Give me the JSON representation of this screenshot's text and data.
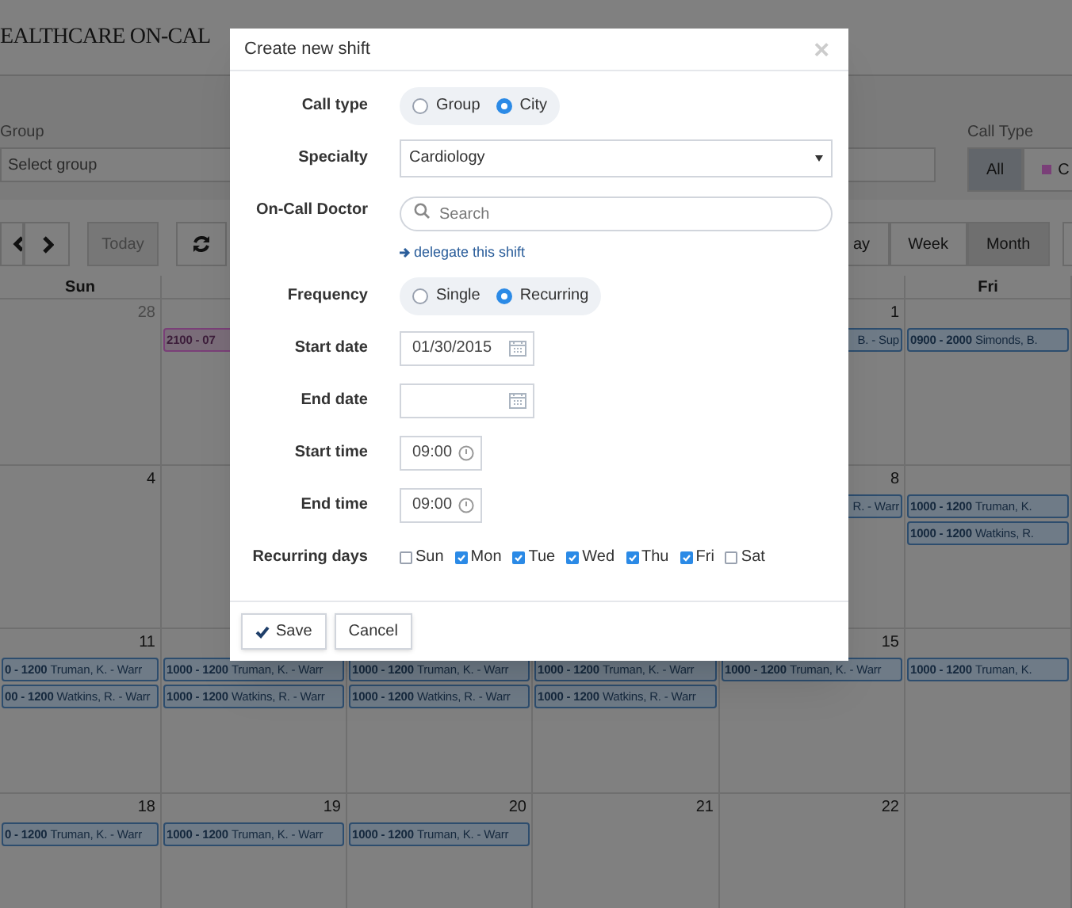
{
  "app_title": "EALTHCARE ON-CAL",
  "filters": {
    "group": {
      "label": "Group",
      "placeholder": "Select group"
    },
    "call_type": {
      "label": "Call Type",
      "options": [
        {
          "label": "All",
          "selected": true
        },
        {
          "label": "C",
          "selected": false,
          "color": "#7a3f78"
        }
      ]
    }
  },
  "toolbar": {
    "today": "Today",
    "views": [
      {
        "label": "ay",
        "selected": false
      },
      {
        "label": "Week",
        "selected": false
      },
      {
        "label": "Month",
        "selected": true
      }
    ]
  },
  "calendar": {
    "headers": {
      "column_1": "Sun",
      "column_6": "Fri"
    },
    "weeks": [
      {
        "days": {
          "column_1": {
            "number": "28"
          },
          "column_2": {
            "events": [
              {
                "time": "2100 - 07",
                "color": "#7a3f78"
              }
            ]
          },
          "column_5": {
            "number": "1",
            "events": [
              {
                "text": "B. - Sup",
                "clipped_left": true,
                "color": "#2d4d6e"
              }
            ]
          },
          "column_6": {
            "events": [
              {
                "time": "0900 - 2000",
                "text": "Simonds, B.",
                "color": "#2d4d6e"
              }
            ]
          }
        }
      },
      {
        "days": {
          "column_1": {
            "number": "4"
          },
          "column_5": {
            "number": "8",
            "events": [
              {
                "text": "R. - Warr",
                "clipped_left": true,
                "color": "#2d4d6e"
              }
            ]
          },
          "column_6": {
            "events": [
              {
                "time": "1000 - 1200",
                "text": "Truman, K.",
                "color": "#2d4d6e"
              },
              {
                "time": "1000 - 1200",
                "text": "Watkins, R.",
                "color": "#2d4d6e"
              }
            ]
          }
        }
      },
      {
        "days": {
          "column_1": {
            "number": "11",
            "events": [
              {
                "time": "0 - 1200",
                "text": "Truman, K. - Warr",
                "color": "#2d4d6e"
              },
              {
                "time": "00 - 1200",
                "text": "Watkins, R. - Warr",
                "color": "#2d4d6e"
              }
            ]
          },
          "column_2": {
            "events": [
              {
                "time": "1000 - 1200",
                "text": "Truman, K. - Warr",
                "color": "#2d4d6e"
              },
              {
                "time": "1000 - 1200",
                "text": "Watkins, R. - Warr",
                "color": "#2d4d6e"
              }
            ]
          },
          "column_3": {
            "events": [
              {
                "time": "1000 - 1200",
                "text": "Truman, K. - Warr",
                "color": "#2d4d6e"
              },
              {
                "time": "1000 - 1200",
                "text": "Watkins, R. - Warr",
                "color": "#2d4d6e"
              }
            ]
          },
          "column_4": {
            "events": [
              {
                "time": "1000 - 1200",
                "text": "Truman, K. - Warr",
                "color": "#2d4d6e"
              },
              {
                "time": "1000 - 1200",
                "text": "Watkins, R. - Warr",
                "color": "#2d4d6e"
              }
            ]
          },
          "column_5": {
            "number": "15",
            "events": [
              {
                "time": "1000 - 1200",
                "text": "Truman, K. - Warr",
                "color": "#2d4d6e"
              }
            ]
          },
          "column_6": {
            "events": [
              {
                "time": "1000 - 1200",
                "text": "Truman, K.",
                "color": "#2d4d6e"
              }
            ]
          }
        }
      },
      {
        "days": {
          "column_1": {
            "number": "18",
            "events": [
              {
                "time": "0 - 1200",
                "text": "Truman, K. - Warr",
                "color": "#2d4d6e"
              }
            ]
          },
          "column_2": {
            "number": "19",
            "events": [
              {
                "time": "1000 - 1200",
                "text": "Truman, K. - Warr",
                "color": "#2d4d6e"
              }
            ]
          },
          "column_3": {
            "number": "20",
            "events": [
              {
                "time": "1000 - 1200",
                "text": "Truman, K. - Warr",
                "color": "#2d4d6e"
              }
            ]
          },
          "column_4": {
            "number": "21"
          },
          "column_5": {
            "number": "22"
          }
        }
      }
    ]
  },
  "dialog": {
    "title": "Create new shift",
    "close": "×",
    "fields": [
      {
        "kind": "radio",
        "label": "Call type",
        "options": [
          {
            "label": "Group",
            "selected": false
          },
          {
            "label": "City",
            "selected": true
          }
        ]
      },
      {
        "kind": "select",
        "label": "Specialty",
        "value": "Cardiology"
      },
      {
        "kind": "search",
        "label": "On-Call Doctor",
        "placeholder": "Search",
        "link": "delegate this shift"
      },
      {
        "kind": "radio",
        "label": "Frequency",
        "options": [
          {
            "label": "Single",
            "selected": false
          },
          {
            "label": "Recurring",
            "selected": true
          }
        ]
      },
      {
        "kind": "date",
        "label": "Start date",
        "value": "01/30/2015"
      },
      {
        "kind": "date",
        "label": "End date"
      },
      {
        "kind": "time",
        "label": "Start time",
        "value": "09:00"
      },
      {
        "kind": "time",
        "label": "End time",
        "value": "09:00"
      },
      {
        "kind": "days",
        "label": "Recurring days",
        "options": [
          {
            "label": "Sun",
            "checked": false
          },
          {
            "label": "Mon",
            "checked": true
          },
          {
            "label": "Tue",
            "checked": true
          },
          {
            "label": "Wed",
            "checked": true
          },
          {
            "label": "Thu",
            "checked": true
          },
          {
            "label": "Fri",
            "checked": true
          },
          {
            "label": "Sat",
            "checked": false
          }
        ]
      }
    ],
    "buttons": [
      {
        "label": "Save",
        "kind": "confirm"
      },
      {
        "label": "Cancel",
        "kind": "plain"
      }
    ]
  }
}
